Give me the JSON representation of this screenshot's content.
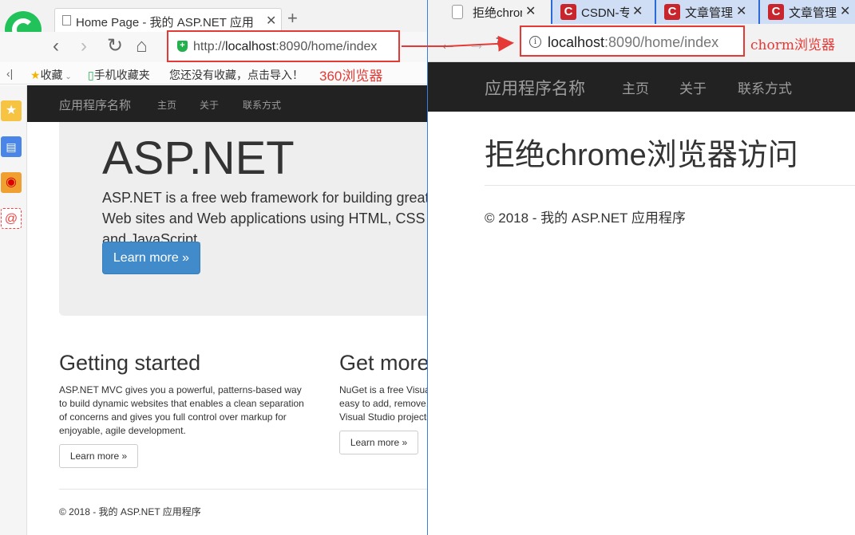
{
  "left_browser": {
    "tab_title": "Home Page - 我的 ASP.NET 应用",
    "tab_close": "✕",
    "new_tab": "+",
    "nav": {
      "back": "‹",
      "forward": "›",
      "refresh": "↻",
      "home": "⌂"
    },
    "address": {
      "scheme": "http://",
      "host": "localhost",
      "rest": ":8090/home/index"
    },
    "favbar": {
      "collapse": "‹|",
      "favorites": "收藏",
      "mobile_favorites": "手机收藏夹",
      "no_favorites": "您还没有收藏，点击导入！",
      "annotation": "360浏览器"
    },
    "sidebar_icons": [
      "star-icon",
      "news-icon",
      "weibo-icon",
      "mail-icon"
    ],
    "site": {
      "brand": "应用程序名称",
      "menu": [
        "主页",
        "关于",
        "联系方式"
      ],
      "jumbotron": {
        "heading": "ASP.NET",
        "lead": "ASP.NET is a free web framework for building great Web sites and Web applications using HTML, CSS and JavaScript.",
        "button": "Learn more »"
      },
      "columns": [
        {
          "heading": "Getting started",
          "text": "ASP.NET MVC gives you a powerful, patterns-based way to build dynamic websites that enables a clean separation of concerns and gives you full control over markup for enjoyable, agile development.",
          "button": "Learn more »"
        },
        {
          "heading": "Get more libraries",
          "text": "NuGet is a free Visual Studio extension that makes it easy to add, remove, and update libraries and tools in Visual Studio projects.",
          "button": "Learn more »"
        }
      ],
      "footer": "© 2018 - 我的 ASP.NET 应用程序"
    }
  },
  "right_browser": {
    "tabs": [
      {
        "label": "拒绝chrome浏览器访问",
        "active": true
      },
      {
        "label": "CSDN-专业IT技术社区",
        "active": false
      },
      {
        "label": "文章管理",
        "active": false
      },
      {
        "label": "文章管理",
        "active": false
      }
    ],
    "tab_close": "✕",
    "nav": {
      "back": "←",
      "forward": "→",
      "refresh": "↻"
    },
    "address": {
      "host": "localhost",
      "rest": ":8090/home/index"
    },
    "annotation": "chorm浏览器",
    "site": {
      "brand": "应用程序名称",
      "menu": [
        "主页",
        "关于",
        "联系方式"
      ],
      "heading": "拒绝chrome浏览器访问",
      "footer": "© 2018 - 我的 ASP.NET 应用程序"
    }
  },
  "colors": {
    "annotation_red": "#e53935",
    "navbar_dark": "#222222",
    "primary_button": "#428bca",
    "chrome_tabstrip": "#2a6bd8"
  }
}
